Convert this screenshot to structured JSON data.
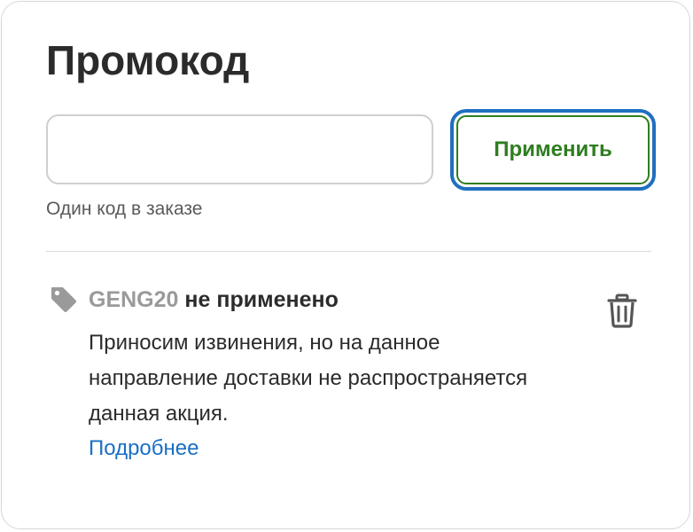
{
  "promo": {
    "title": "Промокод",
    "input_value": "",
    "input_placeholder": "",
    "apply_label": "Применить",
    "hint": "Один код в заказе"
  },
  "applied_code": {
    "code": "GENG20",
    "status": "не применено",
    "message": "Приносим извинения, но на данное направление доставки не распространяется данная акция.",
    "link_label": "Подробнее",
    "icons": {
      "tag": "tag-icon",
      "delete": "trash-icon"
    }
  },
  "colors": {
    "apply_text": "#2f7d1f",
    "focus_ring": "#1f6fc0",
    "link": "#1a6fc4",
    "code_text": "#9a9a9a"
  }
}
